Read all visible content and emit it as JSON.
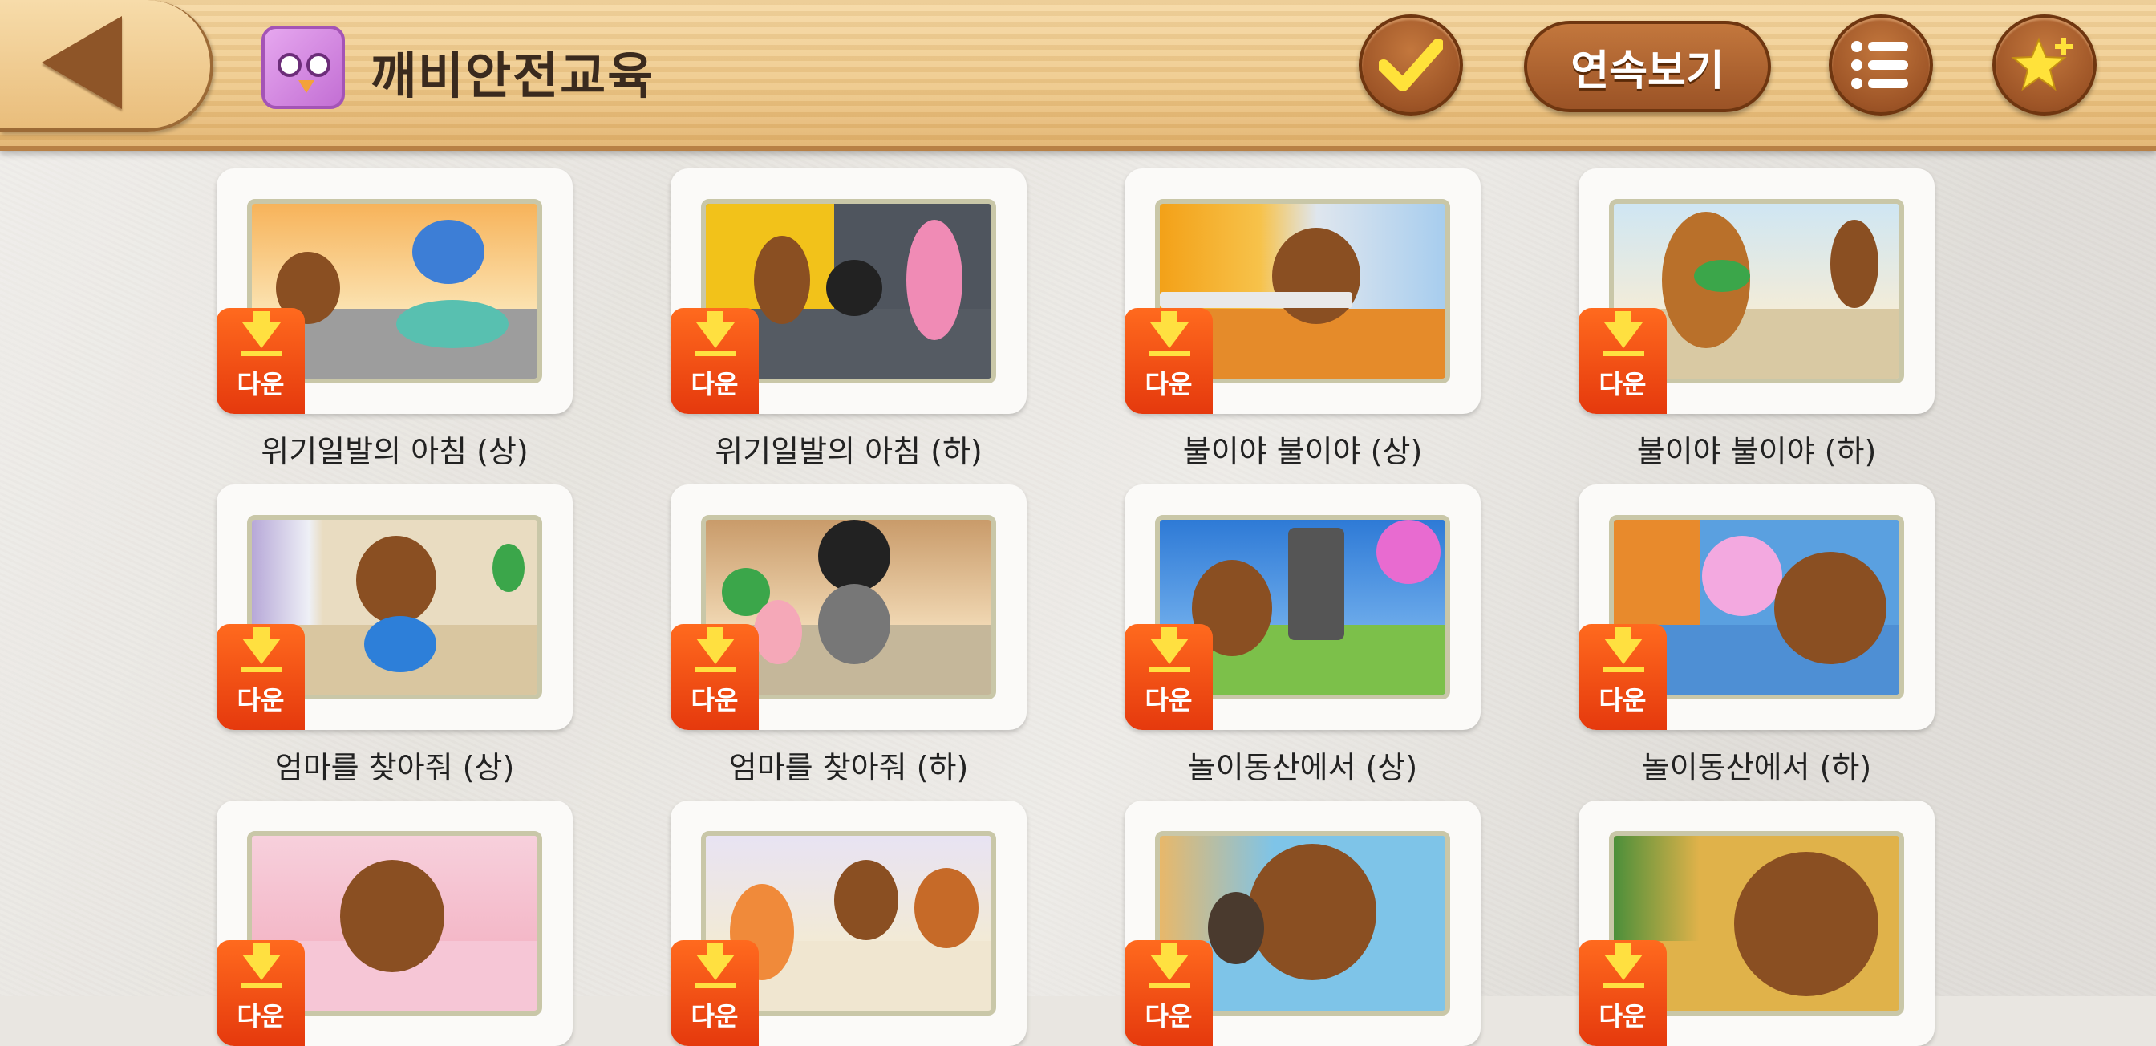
{
  "header": {
    "title": "깨비안전교육",
    "continuous_label": "연속보기"
  },
  "items": [
    {
      "title": "위기일발의 아침 (상)",
      "badge": "다운"
    },
    {
      "title": "위기일발의 아침 (하)",
      "badge": "다운"
    },
    {
      "title": "불이야 불이야 (상)",
      "badge": "다운"
    },
    {
      "title": "불이야 불이야 (하)",
      "badge": "다운"
    },
    {
      "title": "엄마를 찾아줘 (상)",
      "badge": "다운"
    },
    {
      "title": "엄마를 찾아줘 (하)",
      "badge": "다운"
    },
    {
      "title": "놀이동산에서 (상)",
      "badge": "다운"
    },
    {
      "title": "놀이동산에서 (하)",
      "badge": "다운"
    },
    {
      "badge": "다운"
    },
    {
      "badge": "다운"
    },
    {
      "badge": "다운"
    },
    {
      "badge": "다운"
    }
  ],
  "colors": {
    "accent": "#9e5527",
    "badge": "#ff5a1a",
    "check": "#ffe23a"
  }
}
